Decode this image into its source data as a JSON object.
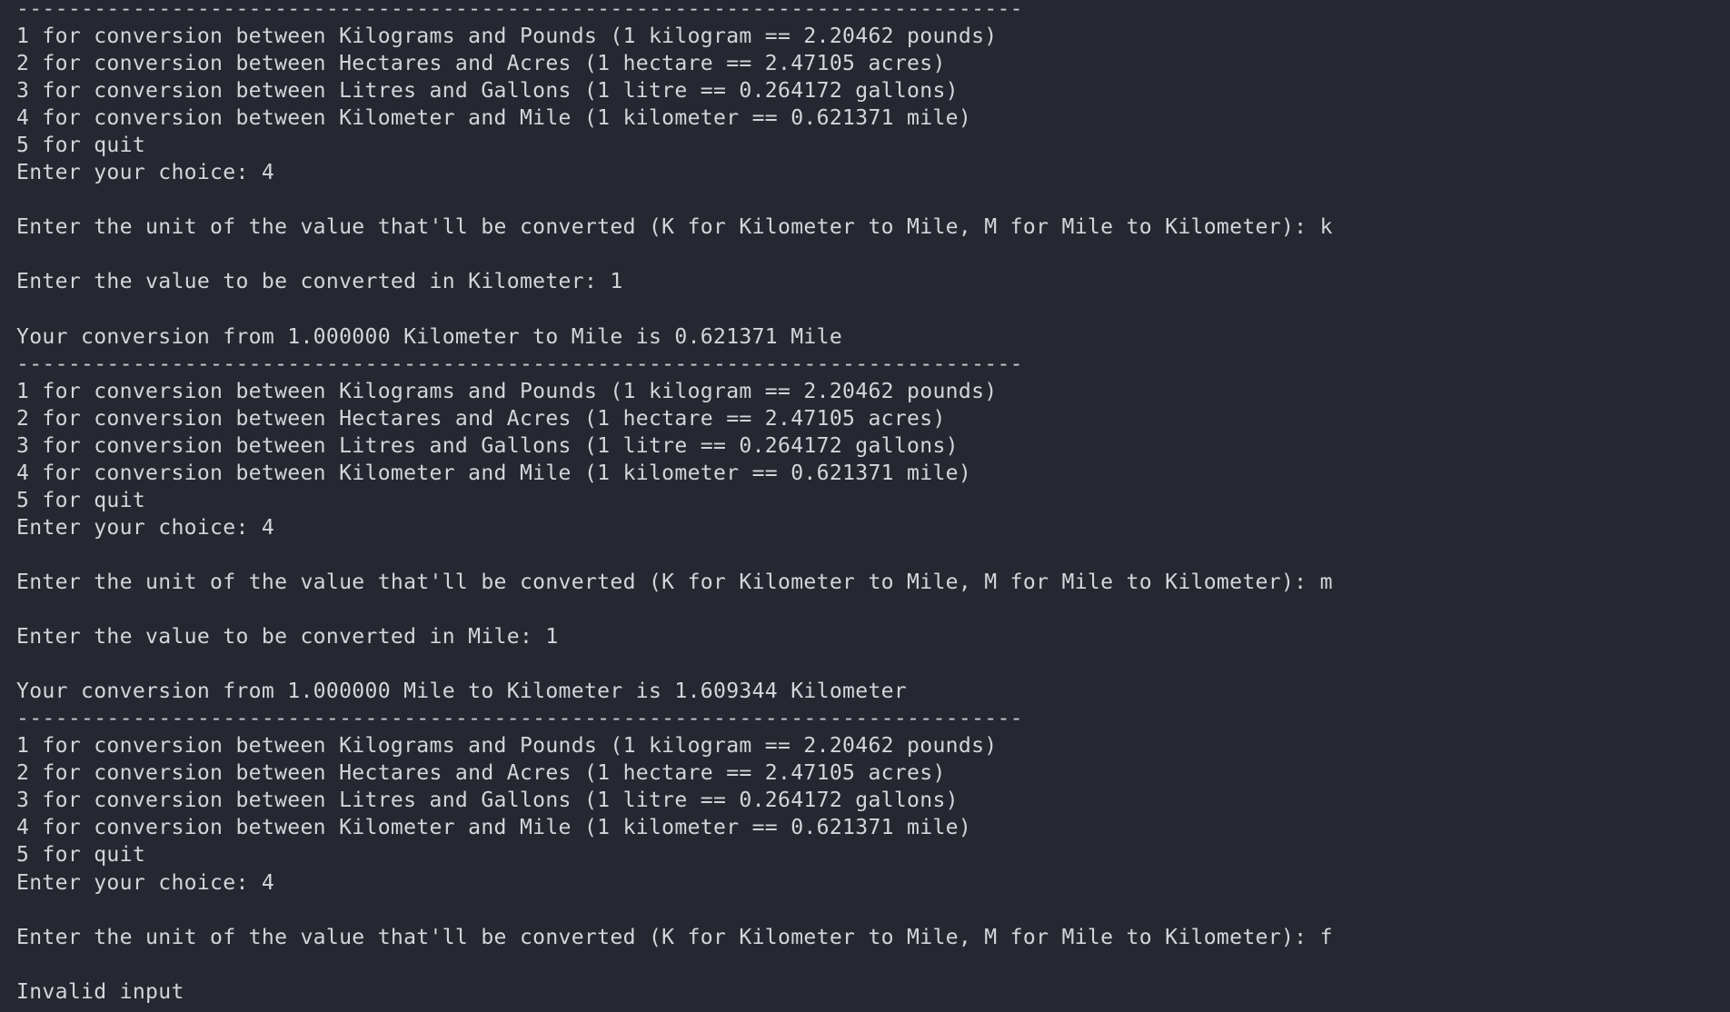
{
  "separator": "------------------------------------------------------------------------------",
  "menu": [
    "1 for conversion between Kilograms and Pounds (1 kilogram == 2.20462 pounds)",
    "2 for conversion between Hectares and Acres (1 hectare == 2.47105 acres)",
    "3 for conversion between Litres and Gallons (1 litre == 0.264172 gallons)",
    "4 for conversion between Kilometer and Mile (1 kilometer == 0.621371 mile)",
    "5 for quit"
  ],
  "sessions": [
    {
      "choice": "Enter your choice: 4",
      "unit_prompt": "Enter the unit of the value that'll be converted (K for Kilometer to Mile, M for Mile to Kilometer): k",
      "value_prompt": "Enter the value to be converted in Kilometer: 1",
      "result": "Your conversion from 1.000000 Kilometer to Mile is 0.621371 Mile"
    },
    {
      "choice": "Enter your choice: 4",
      "unit_prompt": "Enter the unit of the value that'll be converted (K for Kilometer to Mile, M for Mile to Kilometer): m",
      "value_prompt": "Enter the value to be converted in Mile: 1",
      "result": "Your conversion from 1.000000 Mile to Kilometer is 1.609344 Kilometer"
    },
    {
      "choice": "Enter your choice: 4",
      "unit_prompt": "Enter the unit of the value that'll be converted (K for Kilometer to Mile, M for Mile to Kilometer): f",
      "result": "Invalid input"
    }
  ]
}
